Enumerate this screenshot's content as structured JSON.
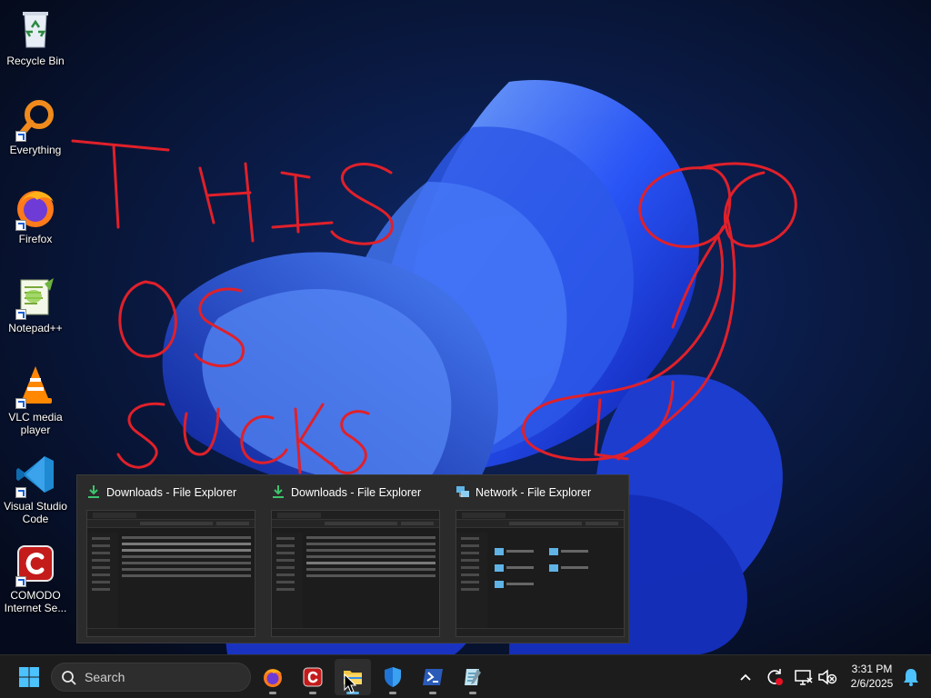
{
  "desktop": {
    "icons": [
      {
        "label": "Recycle Bin",
        "icon": "recycle-bin-icon"
      },
      {
        "label": "Everything",
        "icon": "everything-search-icon"
      },
      {
        "label": "Firefox",
        "icon": "firefox-icon"
      },
      {
        "label": "Notepad++",
        "icon": "notepad-plus-plus-icon"
      },
      {
        "label": "VLC media player",
        "icon": "vlc-icon"
      },
      {
        "label": "Visual Studio Code",
        "icon": "vscode-icon"
      },
      {
        "label": "COMODO Internet Se...",
        "icon": "comodo-icon"
      }
    ],
    "wallpaper_scribble_text": "THIS OS SUCKS"
  },
  "thumbnail_preview": {
    "windows": [
      {
        "title": "Downloads - File Explorer",
        "icon": "download-icon"
      },
      {
        "title": "Downloads - File Explorer",
        "icon": "download-icon"
      },
      {
        "title": "Network - File Explorer",
        "icon": "network-icon"
      }
    ]
  },
  "taskbar": {
    "search_placeholder": "Search",
    "apps": [
      {
        "name": "Firefox",
        "icon": "firefox-icon"
      },
      {
        "name": "COMODO",
        "icon": "comodo-icon"
      },
      {
        "name": "File Explorer",
        "icon": "folder-icon",
        "active": true
      },
      {
        "name": "Windows Security",
        "icon": "shield-icon"
      },
      {
        "name": "PowerShell",
        "icon": "powershell-icon"
      },
      {
        "name": "Notepad",
        "icon": "notepad-icon"
      }
    ],
    "tray": {
      "icons": [
        "chevron-up-icon",
        "sync-alert-icon",
        "network-disconnected-icon",
        "volume-muted-icon",
        "notification-bell-icon"
      ],
      "time": "3:31 PM",
      "date": "2/6/2025"
    }
  },
  "colors": {
    "accent": "#5fb3e6",
    "scribble": "#e0202a",
    "taskbar": "#1c1c1c"
  }
}
